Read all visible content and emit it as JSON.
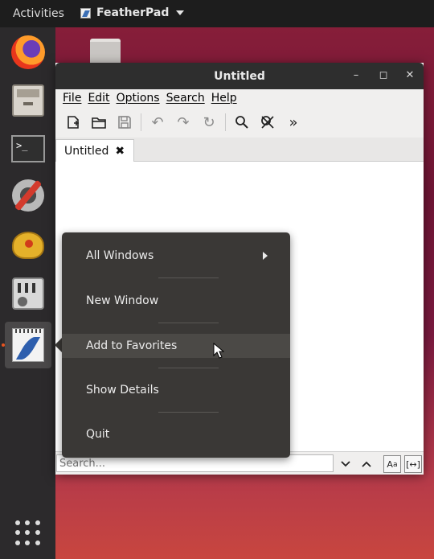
{
  "topbar": {
    "activities": "Activities",
    "app_name": "FeatherPad"
  },
  "window": {
    "title": "Untitled",
    "menu": [
      "File",
      "Edit",
      "Options",
      "Search",
      "Help"
    ],
    "tab_label": "Untitled",
    "tab_close": "✖",
    "search_placeholder": "Search..."
  },
  "context_menu": {
    "items": [
      "All Windows",
      "New Window",
      "Add to Favorites",
      "Show Details",
      "Quit"
    ],
    "hovered": "Add to Favorites"
  },
  "colors": {
    "dock": "#2c2a2c",
    "topbar": "#1d1d1d",
    "menu_bg": "#3a3836",
    "accent": "#e95420"
  }
}
